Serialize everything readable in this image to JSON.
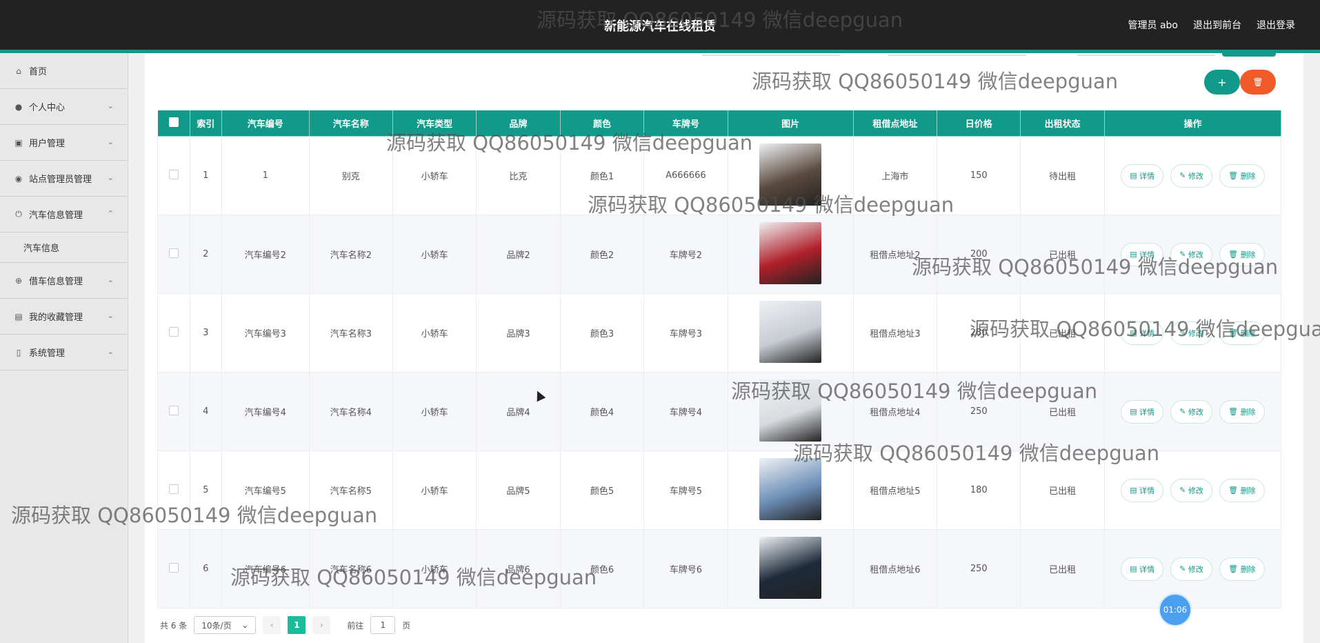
{
  "header": {
    "title": "新能源汽车在线租赁",
    "admin_label": "管理员 abo",
    "to_front": "退出到前台",
    "logout": "退出登录"
  },
  "sidebar": {
    "items": [
      {
        "label": "首页",
        "icon": "home-icon"
      },
      {
        "label": "个人中心",
        "icon": "user-icon"
      },
      {
        "label": "用户管理",
        "icon": "clipboard-icon"
      },
      {
        "label": "站点管理员管理",
        "icon": "pin-icon"
      },
      {
        "label": "汽车信息管理",
        "icon": "power-icon"
      },
      {
        "label": "借车信息管理",
        "icon": "target-icon"
      },
      {
        "label": "我的收藏管理",
        "icon": "bag-icon"
      },
      {
        "label": "系统管理",
        "icon": "badge-icon"
      }
    ],
    "sub_item": "汽车信息"
  },
  "actions": {
    "add": "+",
    "delete": "🗑"
  },
  "table": {
    "headers": [
      "索引",
      "汽车编号",
      "汽车名称",
      "汽车类型",
      "品牌",
      "颜色",
      "车牌号",
      "图片",
      "租借点地址",
      "日价格",
      "出租状态",
      "操作"
    ],
    "rows": [
      {
        "idx": "1",
        "code": "1",
        "name": "别克",
        "type": "小轿车",
        "brand": "比克",
        "color": "颜色1",
        "plate": "A666666",
        "addr": "上海市",
        "price": "150",
        "status": "待出租",
        "img_color": "#5a4a3e"
      },
      {
        "idx": "2",
        "code": "汽车编号2",
        "name": "汽车名称2",
        "type": "小轿车",
        "brand": "品牌2",
        "color": "颜色2",
        "plate": "车牌号2",
        "addr": "租借点地址2",
        "price": "200",
        "status": "已出租",
        "img_color": "#b0202a"
      },
      {
        "idx": "3",
        "code": "汽车编号3",
        "name": "汽车名称3",
        "type": "小轿车",
        "brand": "品牌3",
        "color": "颜色3",
        "plate": "车牌号3",
        "addr": "租借点地址3",
        "price": "280",
        "status": "已出租",
        "img_color": "#c7ccd2"
      },
      {
        "idx": "4",
        "code": "汽车编号4",
        "name": "汽车名称4",
        "type": "小轿车",
        "brand": "品牌4",
        "color": "颜色4",
        "plate": "车牌号4",
        "addr": "租借点地址4",
        "price": "250",
        "status": "已出租",
        "img_color": "#d9dbe0"
      },
      {
        "idx": "5",
        "code": "汽车编号5",
        "name": "汽车名称5",
        "type": "小轿车",
        "brand": "品牌5",
        "color": "颜色5",
        "plate": "车牌号5",
        "addr": "租借点地址5",
        "price": "180",
        "status": "已出租",
        "img_color": "#6d8fb8"
      },
      {
        "idx": "6",
        "code": "汽车编号6",
        "name": "汽车名称6",
        "type": "小轿车",
        "brand": "品牌6",
        "color": "颜色6",
        "plate": "车牌号6",
        "addr": "租借点地址6",
        "price": "250",
        "status": "已出租",
        "img_color": "#1e2a3a"
      }
    ],
    "op_detail": "详情",
    "op_edit": "修改",
    "op_delete": "删除"
  },
  "pager": {
    "total": "共 6 条",
    "page_size": "10条/页",
    "current": "1",
    "goto_prefix": "前往",
    "goto_value": "1",
    "goto_suffix": "页"
  },
  "timer": "01:06",
  "watermark": "源码获取 QQ86050149 微信deepguan",
  "colors": {
    "accent": "#119a8a",
    "danger": "#f05a28",
    "header_bg": "#222222"
  }
}
